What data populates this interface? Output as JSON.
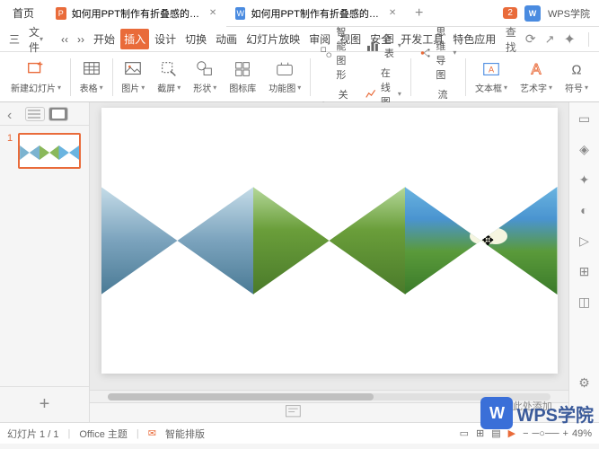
{
  "tabs": {
    "home": "首页",
    "file1": "如何用PPT制作有折叠感的图片.pptx",
    "file2": "如何用PPT制作有折叠感的图片.docx"
  },
  "titlebar": {
    "msg_count": "2",
    "wps": "W",
    "academy": "WPS学院"
  },
  "menu": {
    "triple": "三",
    "file": "文件",
    "items": [
      "开始",
      "插入",
      "设计",
      "切换",
      "动画",
      "幻灯片放映",
      "审阅",
      "视图",
      "安全",
      "开发工具",
      "特色应用"
    ],
    "search": "查找"
  },
  "toolbar": {
    "newslide": "新建幻灯片",
    "table": "表格",
    "image": "图片",
    "screenshot": "截屏",
    "shape": "形状",
    "iconlib": "图标库",
    "funcimg": "功能图",
    "smartshape": "智能图形",
    "chart": "图表",
    "rel": "关系图",
    "onlinechart": "在线图表",
    "mindmap": "思维导图",
    "flow": "流程图",
    "textbox": "文本框",
    "wordart": "艺术字",
    "symbol": "符号"
  },
  "slides": {
    "num1": "1"
  },
  "notes": "单击此处添加备注",
  "status": {
    "page": "幻灯片 1 / 1",
    "office": "Office 主题",
    "smart": "智能排版",
    "zoom": "49%"
  },
  "watermark": {
    "logo": "W",
    "text": "WPS学院"
  }
}
